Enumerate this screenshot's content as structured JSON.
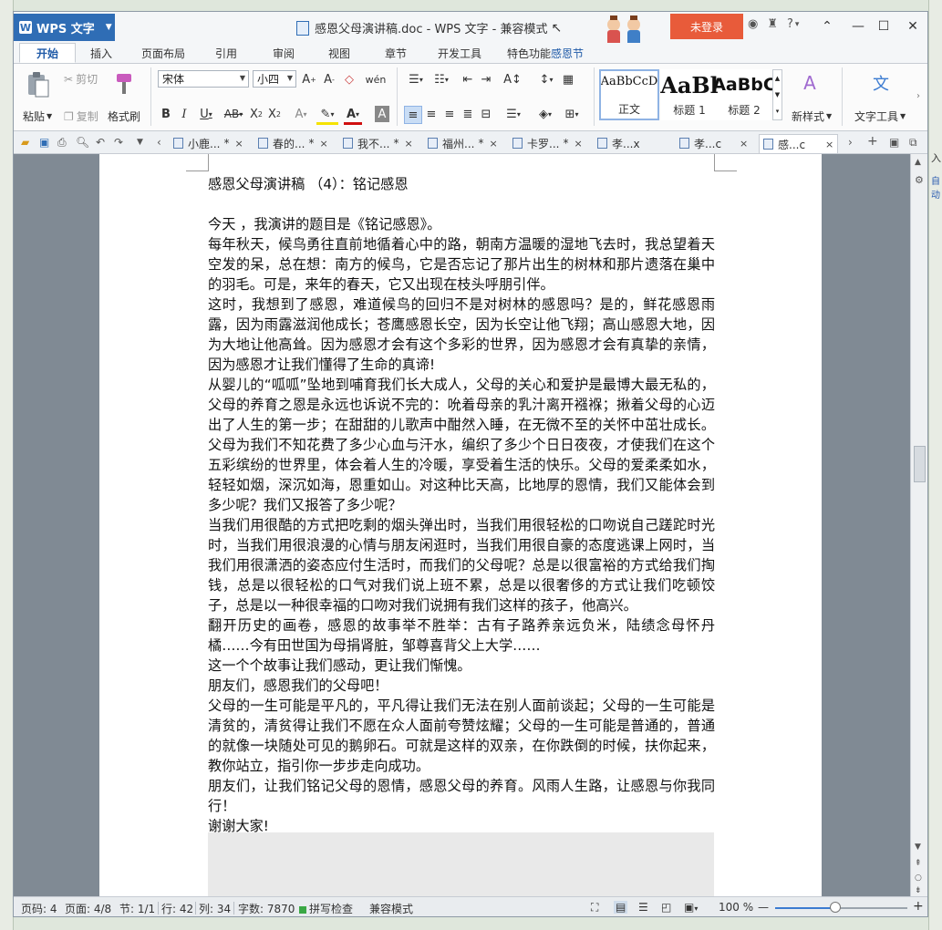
{
  "app": {
    "name": "WPS 文字",
    "doc_title": "感恩父母演讲稿.doc - WPS 文字 - 兼容模式",
    "login": "未登录",
    "festival": "感恩节"
  },
  "ribbon_tabs": [
    "开始",
    "插入",
    "页面布局",
    "引用",
    "审阅",
    "视图",
    "章节",
    "开发工具",
    "特色功能"
  ],
  "ribbon": {
    "paste": "粘贴",
    "cut": "剪切",
    "copy": "复制",
    "format_painter": "格式刷",
    "font_name": "宋体",
    "font_size": "小四",
    "styles": [
      {
        "preview": "AaBbCcD",
        "label": "正文"
      },
      {
        "preview": "AaBl",
        "label": "标题 1"
      },
      {
        "preview": "AaBbC",
        "label": "标题 2"
      }
    ],
    "new_style": "新样式",
    "text_tools": "文字工具"
  },
  "doc_tabs": [
    {
      "label": "小鹿...",
      "modified": "*",
      "close": "×"
    },
    {
      "label": "春的...",
      "modified": "*",
      "close": "×"
    },
    {
      "label": "我不...",
      "modified": "*",
      "close": "×"
    },
    {
      "label": "福州...",
      "modified": "*",
      "close": "×"
    },
    {
      "label": "卡罗...",
      "modified": "*",
      "close": "×"
    },
    {
      "label": "孝...x",
      "modified": "",
      "close": ""
    },
    {
      "label": "孝...c",
      "modified": "",
      "close": "×"
    },
    {
      "label": "感...c",
      "modified": "",
      "close": "×"
    }
  ],
  "document": {
    "title": "感恩父母演讲稿 （4）：铭记感恩",
    "paragraphs": [
      "今天 ，我演讲的题目是《铭记感恩》。",
      "每年秋天，候鸟勇往直前地循着心中的路，朝南方温暖的湿地飞去时，我总望着天空发的呆，总在想：南方的候鸟，它是否忘记了那片出生的树林和那片遗落在巢中的羽毛。可是，来年的春天，它又出现在枝头呼朋引伴。",
      "这时，我想到了感恩，难道候鸟的回归不是对树林的感恩吗？是的，鲜花感恩雨露，因为雨露滋润他成长；苍鹰感恩长空，因为长空让他飞翔；高山感恩大地，因为大地让他高耸。因为感恩才会有这个多彩的世界，因为感恩才会有真挚的亲情，因为感恩才让我们懂得了生命的真谛!",
      "从婴儿的“呱呱”坠地到哺育我们长大成人，父母的关心和爱护是最博大最无私的，父母的养育之恩是永远也诉说不完的：吮着母亲的乳汁离开襁褓；揪着父母的心迈出了人生的第一步；在甜甜的儿歌声中酣然入睡，在无微不至的关怀中茁壮成长。父母为我们不知花费了多少心血与汗水，编织了多少个日日夜夜，才使我们在这个五彩缤纷的世界里，体会着人生的冷暖，享受着生活的快乐。父母的爱柔柔如水，轻轻如烟，深沉如海，恩重如山。对这种比天高，比地厚的恩情，我们又能体会到多少呢？我们又报答了多少呢？",
      "当我们用很酷的方式把吃剩的烟头弹出时，当我们用很轻松的口吻说自己蹉跎时光时，当我们用很浪漫的心情与朋友闲逛时，当我们用很自豪的态度逃课上网时，当我们用很潇洒的姿态应付生活时，而我们的父母呢？总是以很富裕的方式给我们掏钱，总是以很轻松的口气对我们说上班不累，总是以很奢侈的方式让我们吃顿饺子，总是以一种很幸福的口吻对我们说拥有我们这样的孩子，他高兴。",
      "翻开历史的画卷，感恩的故事举不胜举：古有子路养亲远负米，陆绩念母怀丹橘……今有田世国为母捐肾脏，邹尊喜背父上大学……",
      "这一个个故事让我们感动，更让我们惭愧。",
      "朋友们，感恩我们的父母吧！",
      "父母的一生可能是平凡的，平凡得让我们无法在别人面前谈起；父母的一生可能是清贫的，清贫得让我们不愿在众人面前夸赞炫耀；父母的一生可能是普通的，普通的就像一块随处可见的鹅卵石。可就是这样的双亲，在你跌倒的时候，扶你起来，教你站立，指引你一步步走向成功。",
      "朋友们，让我们铭记父母的恩情，感恩父母的养育。风雨人生路，让感恩与你我同行！",
      "谢谢大家!"
    ]
  },
  "status": {
    "page_no": "页码: 4",
    "pages": "页面: 4/8",
    "section": "节: 1/1",
    "row": "行: 42",
    "col": "列: 34",
    "word_count": "字数: 7870",
    "spell_check": "拼写检查",
    "compat": "兼容模式",
    "zoom": "100 %"
  },
  "desktop_fragments": [
    "入",
    "自动"
  ],
  "colors": {
    "app_blue": "#2f6db5",
    "login_orange": "#e85b3a",
    "accent_blue": "#3b7bd1"
  }
}
